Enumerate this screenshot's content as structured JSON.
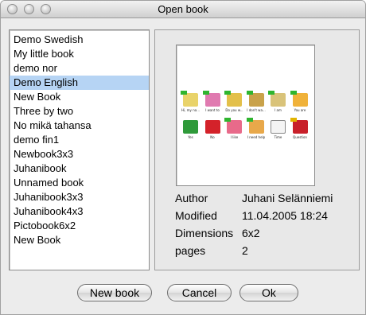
{
  "window": {
    "title": "Open book"
  },
  "books": [
    "Demo Swedish",
    "My little book",
    "demo nor",
    "Demo English",
    "New Book",
    "Three by two",
    "No mikä tahansa",
    "demo fin1",
    "Newbook3x3",
    "Juhanibook",
    "Unnamed book",
    "Juhanibook3x3",
    "Juhanibook4x3",
    "Pictobook6x2",
    "New Book"
  ],
  "selected_index": 3,
  "preview": {
    "cells": [
      {
        "caption": "Hi, my na...",
        "color": "#e9d36a",
        "tab": "#2fb52f"
      },
      {
        "caption": "I want to",
        "color": "#e07ab0",
        "tab": "#2fb52f"
      },
      {
        "caption": "Do you w...",
        "color": "#e3c04a",
        "tab": "#2fb52f"
      },
      {
        "caption": "I don't wa...",
        "color": "#c9a24a",
        "tab": "#2fb52f"
      },
      {
        "caption": "I am",
        "color": "#d9c37a",
        "tab": "#2fb52f"
      },
      {
        "caption": "You are",
        "color": "#f0b23a",
        "tab": "#2fb52f"
      },
      {
        "caption": "Yes",
        "color": "#2f9a3a",
        "tab": ""
      },
      {
        "caption": "No",
        "color": "#d4222a",
        "tab": ""
      },
      {
        "caption": "I like",
        "color": "#e86a8a",
        "tab": "#2fb52f"
      },
      {
        "caption": "I need help",
        "color": "#e8a84a",
        "tab": "#2fb52f"
      },
      {
        "caption": "Time",
        "color": "#f4f4f4",
        "tab": ""
      },
      {
        "caption": "Question",
        "color": "#c8202a",
        "tab": "#e2b400"
      }
    ]
  },
  "details": {
    "author_label": "Author",
    "author": "Juhani Selänniemi",
    "modified_label": "Modified",
    "modified": "11.04.2005 18:24",
    "dimensions_label": "Dimensions",
    "dimensions": "6x2",
    "pages_label": "pages",
    "pages": "2"
  },
  "buttons": {
    "new_book": "New book",
    "cancel": "Cancel",
    "ok": "Ok"
  }
}
